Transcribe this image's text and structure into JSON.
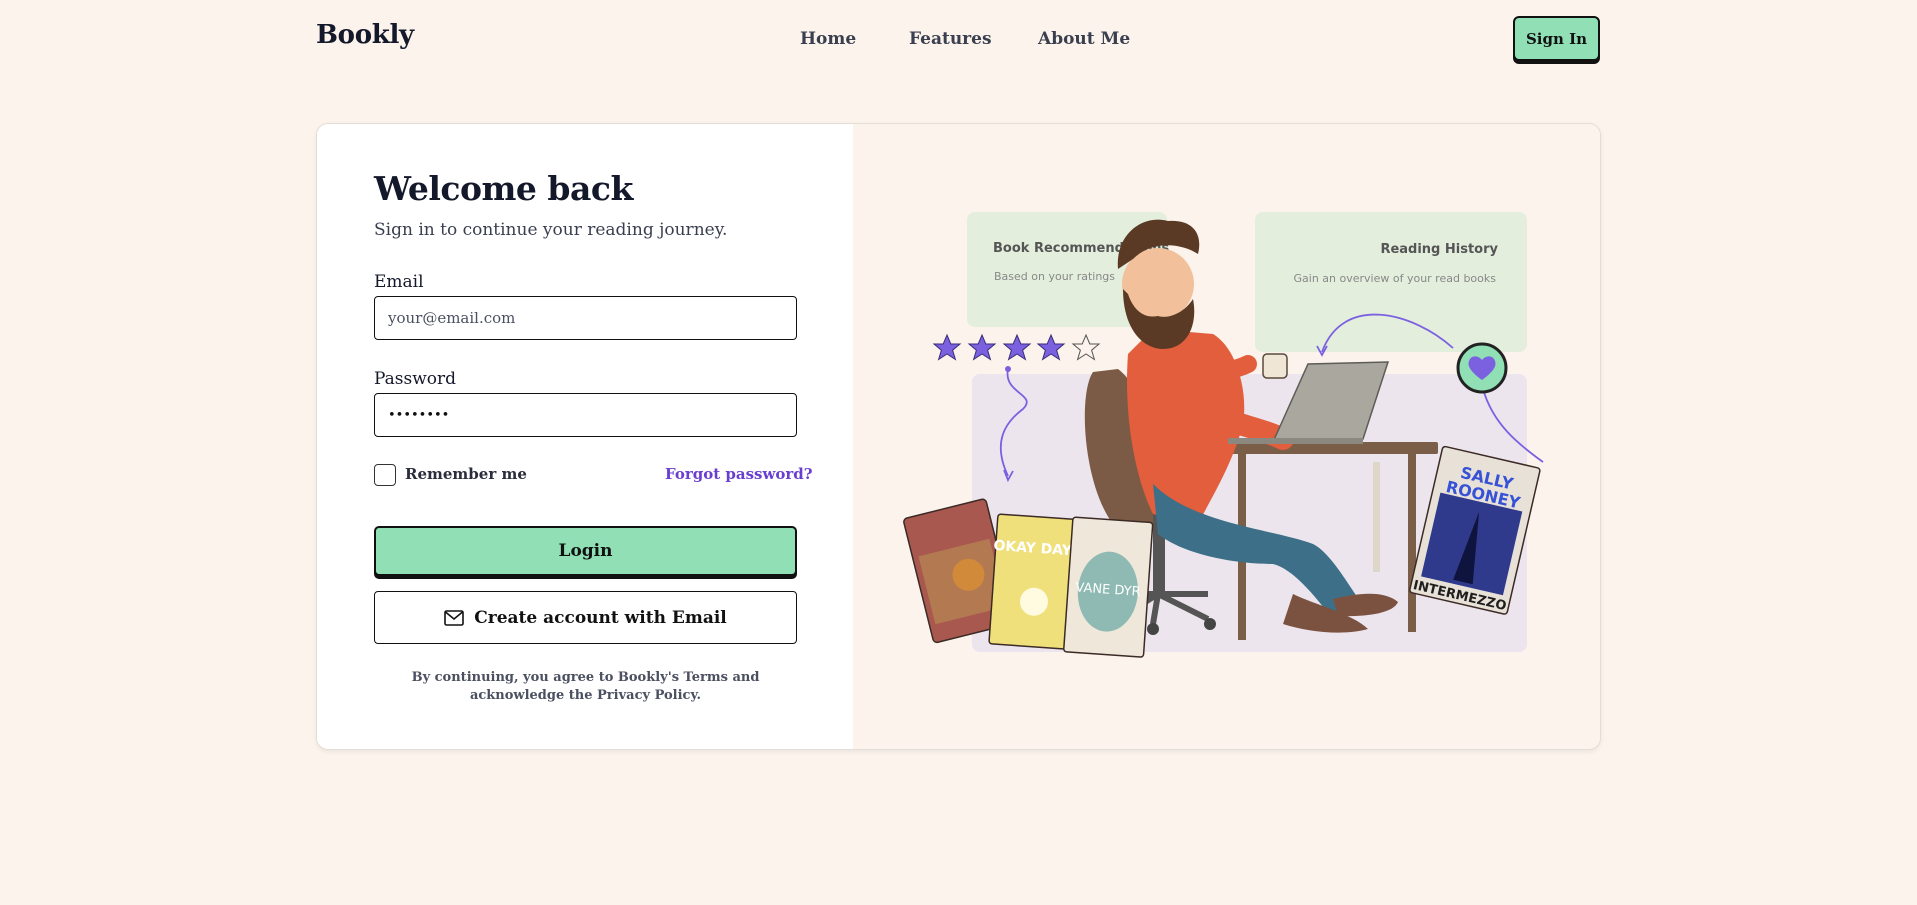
{
  "header": {
    "brand": "Bookly",
    "nav": [
      {
        "label": "Home"
      },
      {
        "label": "Features"
      },
      {
        "label": "About Me"
      }
    ],
    "signin_label": "Sign In"
  },
  "login": {
    "title": "Welcome back",
    "subtitle": "Sign in to continue your reading journey.",
    "email_label": "Email",
    "email_placeholder": "your@email.com",
    "password_label": "Password",
    "password_value": "••••••••",
    "remember_label": "Remember me",
    "forgot_label": "Forgot password?",
    "login_label": "Login",
    "create_label": "Create account with Email",
    "terms": "By continuing, you agree to Bookly's Terms and acknowledge the Privacy Policy."
  },
  "illustration": {
    "card1_title": "Book Recommendations",
    "card1_sub": "Based on your ratings",
    "card2_title": "Reading History",
    "card2_sub": "Gain an overview of your read books",
    "rating": {
      "value": 4,
      "max": 5
    },
    "books": [
      {
        "title": "OKAY DAYS"
      },
      {
        "title": "VANE DYR"
      },
      {
        "title_line1": "SALLY",
        "title_line2": "ROONEY",
        "title_line3": "INTERMEZZO"
      }
    ],
    "colors": {
      "accent_green": "#90dfb5",
      "accent_purple": "#7b61e0",
      "card_green": "#e3eedd",
      "card_lavender": "#ece5ee"
    }
  }
}
